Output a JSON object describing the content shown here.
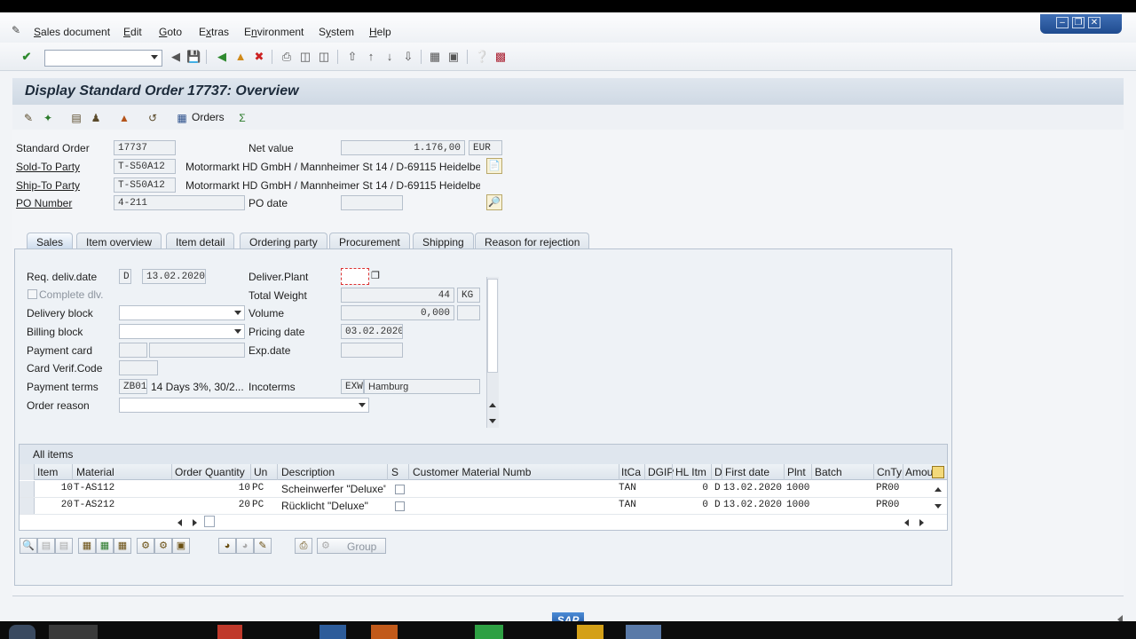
{
  "menubar": {
    "items": [
      {
        "pre": "",
        "u": "S",
        "post": "ales document"
      },
      {
        "pre": "",
        "u": "E",
        "post": "dit"
      },
      {
        "pre": "",
        "u": "G",
        "post": "oto"
      },
      {
        "pre": "E",
        "u": "x",
        "post": "tras"
      },
      {
        "pre": "E",
        "u": "n",
        "post": "vironment"
      },
      {
        "pre": "S",
        "u": "y",
        "post": "stem"
      },
      {
        "pre": "",
        "u": "H",
        "post": "elp"
      }
    ]
  },
  "title": "Display Standard Order 17737: Overview",
  "apptoolbar": {
    "orders_label": "Orders"
  },
  "header": {
    "standard_order_label": "Standard Order",
    "standard_order_value": "17737",
    "net_value_label": "Net value",
    "net_value_value": "1.176,00",
    "net_value_currency": "EUR",
    "sold_to_label": "Sold-To Party",
    "sold_to_value": "T-S50A12",
    "sold_to_text": "Motormarkt HD GmbH / Mannheimer St 14 / D-69115 Heidelbe...",
    "ship_to_label": "Ship-To Party",
    "ship_to_value": "T-S50A12",
    "ship_to_text": "Motormarkt HD GmbH / Mannheimer St 14 / D-69115 Heidelbe...",
    "po_number_label": "PO Number",
    "po_number_value": "4-211",
    "po_date_label": "PO date",
    "po_date_value": ""
  },
  "tabs": [
    "Sales",
    "Item overview",
    "Item detail",
    "Ordering party",
    "Procurement",
    "Shipping",
    "Reason for rejection"
  ],
  "sales": {
    "req_deliv_label": "Req. deliv.date",
    "req_deliv_type": "D",
    "req_deliv_value": "13.02.2020",
    "deliver_plant_label": "Deliver.Plant",
    "complete_dlv_label": "Complete dlv.",
    "total_weight_label": "Total Weight",
    "total_weight_value": "44",
    "total_weight_unit": "KG",
    "delivery_block_label": "Delivery block",
    "volume_label": "Volume",
    "volume_value": "0,000",
    "billing_block_label": "Billing block",
    "pricing_date_label": "Pricing date",
    "pricing_date_value": "03.02.2020",
    "payment_card_label": "Payment card",
    "exp_date_label": "Exp.date",
    "card_verif_label": "Card Verif.Code",
    "payment_terms_label": "Payment terms",
    "payment_terms_code": "ZB01",
    "payment_terms_text": "14 Days 3%, 30/2...",
    "incoterms_label": "Incoterms",
    "incoterms_code": "EXW",
    "incoterms_text": "Hamburg",
    "order_reason_label": "Order reason"
  },
  "items": {
    "title": "All items",
    "columns": [
      "Item",
      "Material",
      "Order Quantity",
      "Un",
      "Description",
      "S",
      "Customer Material Numb",
      "ItCa",
      "DGIP",
      "HL Itm",
      "D",
      "First date",
      "Plnt",
      "Batch",
      "CnTy",
      "Amou"
    ],
    "rows": [
      {
        "item": "10",
        "material": "T-AS112",
        "qty": "10",
        "un": "PC",
        "desc": "Scheinwerfer \"Deluxe\"",
        "itca": "TAN",
        "hl": "0",
        "d": "D",
        "first_date": "13.02.2020",
        "plnt": "1000",
        "cnty": "PR00"
      },
      {
        "item": "20",
        "material": "T-AS212",
        "qty": "20",
        "un": "PC",
        "desc": "Rücklicht \"Deluxe\"",
        "itca": "TAN",
        "hl": "0",
        "d": "D",
        "first_date": "13.02.2020",
        "plnt": "1000",
        "cnty": "PR00"
      }
    ]
  },
  "grid_toolbar": {
    "group_label": "Group"
  },
  "sap_logo": "SAP",
  "colors": {
    "accent": "#1f4b8f",
    "tab_active": "#c9d9ec",
    "panel": "#eef2f6"
  }
}
